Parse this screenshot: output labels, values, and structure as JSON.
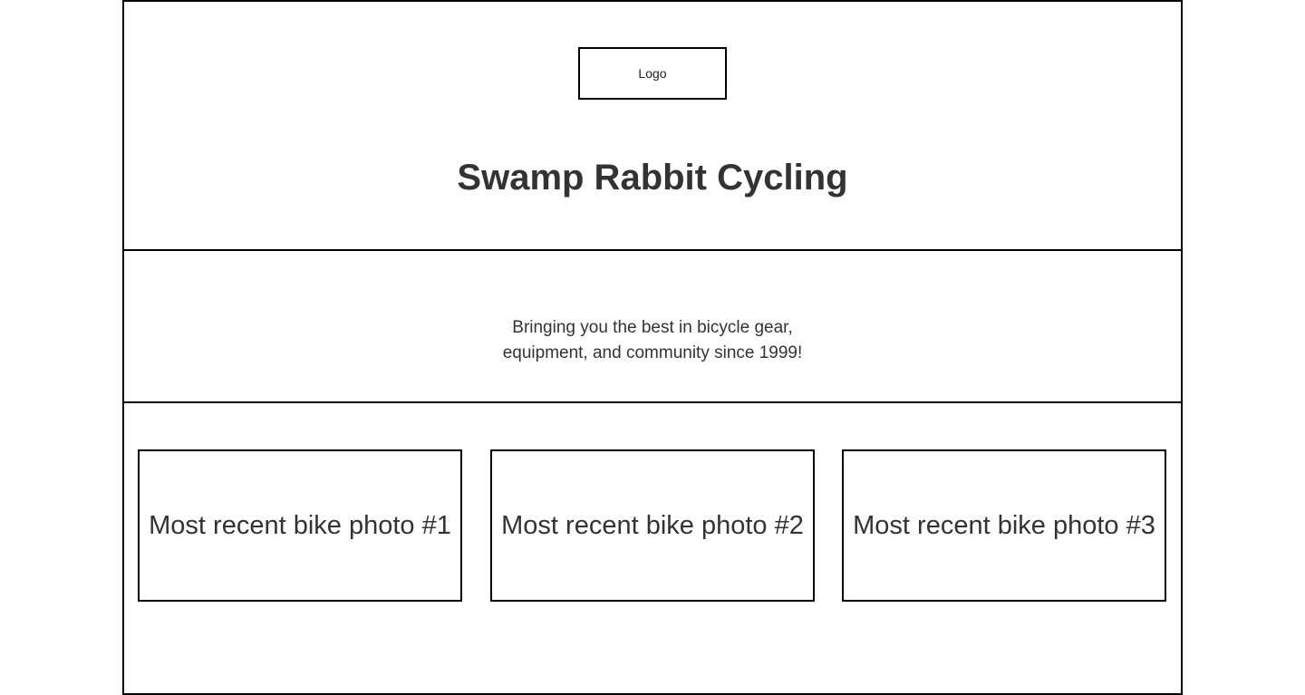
{
  "header": {
    "logo_label": "Logo",
    "site_title": "Swamp Rabbit Cycling"
  },
  "tagline": {
    "line1": "Bringing you the best in bicycle gear,",
    "line2": "equipment, and community since 1999!"
  },
  "photos": [
    {
      "label": "Most recent bike photo #1"
    },
    {
      "label": "Most recent bike photo #2"
    },
    {
      "label": "Most recent bike photo #3"
    }
  ]
}
